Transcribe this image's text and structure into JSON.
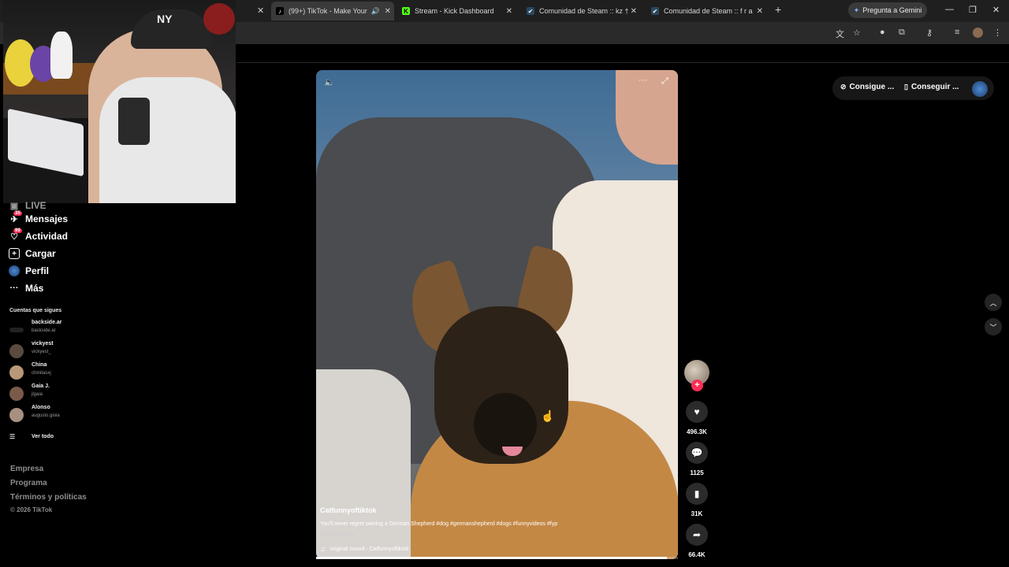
{
  "browser": {
    "tabs": [
      {
        "label": "(99+) TikTok - Make Your D…",
        "active": true
      },
      {
        "label": "Stream - Kick Dashboard",
        "active": false
      },
      {
        "label": "Comunidad de Steam :: kz †",
        "active": false
      },
      {
        "label": "Comunidad de Steam :: f r a",
        "active": false
      }
    ],
    "gemini_label": "Pregunta a Gemini"
  },
  "sidebar": {
    "nav": [
      {
        "label": "LIVE",
        "badge": ""
      },
      {
        "label": "Mensajes",
        "badge": "35"
      },
      {
        "label": "Actividad",
        "badge": "99"
      },
      {
        "label": "Cargar",
        "badge": ""
      },
      {
        "label": "Perfil",
        "badge": ""
      },
      {
        "label": "Más",
        "badge": ""
      }
    ],
    "following_title": "Cuentas que sigues",
    "accounts": [
      {
        "name": "backside.ar",
        "handle": "backside.ar"
      },
      {
        "name": "vickyest",
        "handle": "vickyest_"
      },
      {
        "name": "China",
        "handle": "chinitasxj"
      },
      {
        "name": "Gaia J.",
        "handle": "jlgaia"
      },
      {
        "name": "Alonso",
        "handle": "augusto.gioia"
      }
    ],
    "see_all": "Ver todo",
    "footer": [
      "Empresa",
      "Programa",
      "Términos y políticas"
    ],
    "copyright": "© 2026 TikTok"
  },
  "video": {
    "author": "Catfunnyoftiktok",
    "caption": "You'll never regret owning a German Shepherd #dog #germanshepherd #dogs #funnyvideos #fyp",
    "translate": "Ver traducción",
    "sound": "original sound - Catfunnyoftiktok",
    "progress": 0.97
  },
  "actions": {
    "likes": "496.3K",
    "comments": "1125",
    "saves": "31K",
    "shares": "66.4K"
  },
  "top_right": {
    "coins_label": "Consigue ...",
    "app_label": "Conseguir ..."
  },
  "colors": {
    "accent": "#fe2c55",
    "background": "#000000"
  }
}
